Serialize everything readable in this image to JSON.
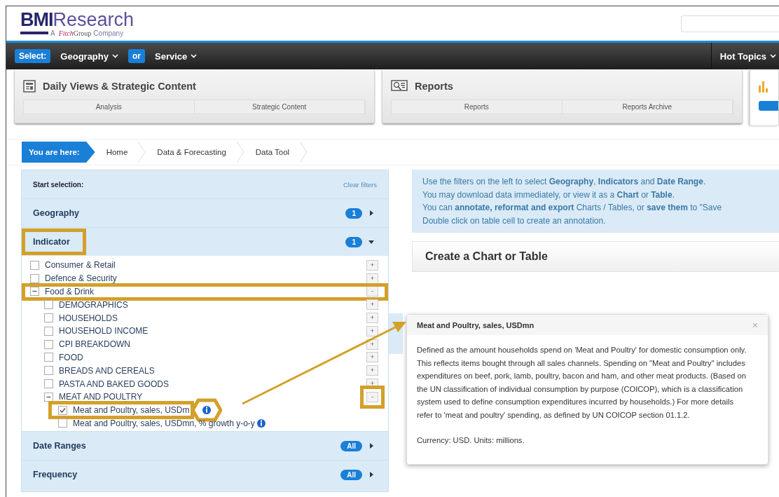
{
  "logo": {
    "brand_bold": "BMI",
    "brand_light": "Research",
    "tagline": {
      "lead": "A",
      "fitch": "Fitch",
      "group": "Group",
      "tail": "Company"
    }
  },
  "nav": {
    "items": [
      {
        "kind": "badge",
        "label": "Select:"
      },
      {
        "kind": "menu",
        "label": "Geography"
      },
      {
        "kind": "badge",
        "label": "or"
      },
      {
        "kind": "menu",
        "label": "Service"
      }
    ],
    "right_menu": "Hot Topics"
  },
  "tab_cards": [
    {
      "kind": "daily",
      "title": "Daily Views & Strategic Content",
      "subtabs": [
        "Analysis",
        "Strategic Content"
      ]
    },
    {
      "kind": "reports",
      "title": "Reports",
      "subtabs": [
        "Reports",
        "Reports Archive"
      ]
    },
    {
      "kind": "chart"
    }
  ],
  "breadcrumb": {
    "label": "You are here:",
    "items": [
      "Home",
      "Data & Forecasting",
      "Data Tool"
    ]
  },
  "filters": {
    "title": "Start selection:",
    "clear": "Clear filters",
    "sections": [
      {
        "name": "Geography",
        "badge": "1",
        "expanded": false,
        "highlighted": false
      },
      {
        "name": "Indicator",
        "badge": "1",
        "expanded": true,
        "highlighted": true,
        "tree": [
          {
            "label": "Consumer & Retail",
            "checked": false,
            "partial": false,
            "toggle": "+",
            "highlighted": false,
            "toggle_highlighted": false
          },
          {
            "label": "Defence & Security",
            "checked": false,
            "partial": false,
            "toggle": "+",
            "highlighted": false,
            "toggle_highlighted": false
          },
          {
            "label": "Food & Drink",
            "checked": false,
            "partial": true,
            "toggle": "-",
            "highlighted": true,
            "toggle_highlighted": false,
            "children": [
              {
                "label": "DEMOGRAPHICS",
                "checked": false,
                "partial": false,
                "toggle": "+",
                "highlighted": false,
                "toggle_highlighted": false
              },
              {
                "label": "HOUSEHOLDS",
                "checked": false,
                "partial": false,
                "toggle": "+",
                "highlighted": false,
                "toggle_highlighted": false
              },
              {
                "label": "HOUSEHOLD INCOME",
                "checked": false,
                "partial": false,
                "toggle": "+",
                "highlighted": false,
                "toggle_highlighted": false
              },
              {
                "label": "CPI BREAKDOWN",
                "checked": false,
                "partial": false,
                "toggle": "+",
                "highlighted": false,
                "toggle_highlighted": false
              },
              {
                "label": "FOOD",
                "checked": false,
                "partial": false,
                "toggle": "+",
                "highlighted": false,
                "toggle_highlighted": false
              },
              {
                "label": "BREADS AND CEREALS",
                "checked": false,
                "partial": false,
                "toggle": "+",
                "highlighted": false,
                "toggle_highlighted": false
              },
              {
                "label": "PASTA AND BAKED GOODS",
                "checked": false,
                "partial": false,
                "toggle": "+",
                "highlighted": false,
                "toggle_highlighted": false
              },
              {
                "label": "MEAT AND POULTRY",
                "checked": false,
                "partial": true,
                "toggle": "-",
                "highlighted": false,
                "toggle_highlighted": true,
                "children": [
                  {
                    "label": "Meat and Poultry, sales, USDm",
                    "checked": true,
                    "info": true,
                    "highlighted": true
                  },
                  {
                    "label": "Meat and Poultry, sales, USDmn, % growth y-o-y",
                    "checked": false,
                    "info": true,
                    "highlighted": false
                  }
                ]
              }
            ]
          }
        ]
      },
      {
        "name": "Date Ranges",
        "badge": "All",
        "expanded": false,
        "highlighted": false
      },
      {
        "name": "Frequency",
        "badge": "All",
        "expanded": false,
        "highlighted": false
      }
    ]
  },
  "info_lines": [
    "Use the filters on the left to select **Geography**, **Indicators** and **Date Range**.",
    "You may download data immediately, or view it as a **Chart** or **Table**.",
    "You can **annotate, reformat and export** Charts / Tables, or **save them** to \"Save",
    "Double click on table cell to create an annotation."
  ],
  "chart_panel": {
    "title": "Create a Chart or Table"
  },
  "tooltip": {
    "title": "Meat and Poultry, sales, USDmn",
    "close": "×",
    "paragraphs": [
      "Defined as the amount households spend on 'Meat and Poultry' for domestic consumption only. This reflects items bought through all sales channels. Spending on \"Meat and Poultry\" includes expenditures on beef, pork, lamb, poultry, bacon and ham, and other meat products. (Based on the UN classification of individual consumption by purpose (COICOP), which is a classification system used to define consumption expenditures incurred by households.) For more details refer to 'meat and poultry' spending, as defined by UN COICOP section 01.1.2.",
      "Currency: USD. Units: millions."
    ]
  }
}
